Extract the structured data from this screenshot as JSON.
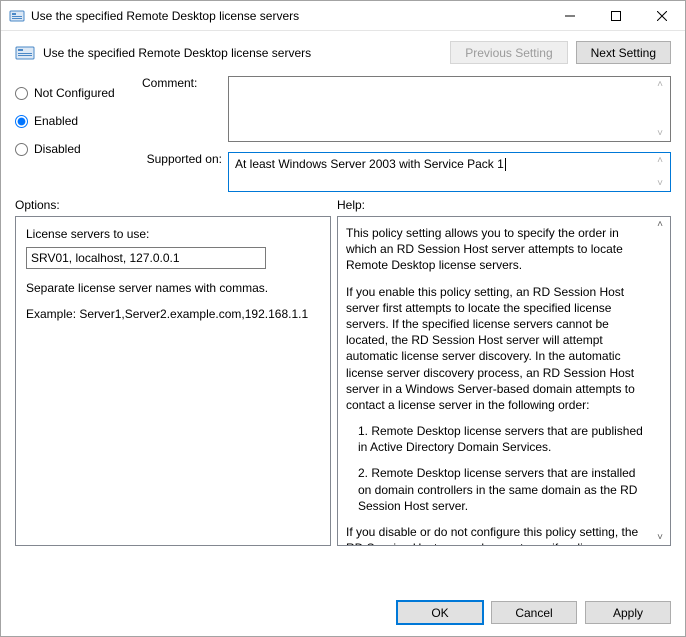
{
  "window": {
    "title": "Use the specified Remote Desktop license servers"
  },
  "header": {
    "policy_name": "Use the specified Remote Desktop license servers",
    "prev_label": "Previous Setting",
    "next_label": "Next Setting"
  },
  "state": {
    "not_configured_label": "Not Configured",
    "enabled_label": "Enabled",
    "disabled_label": "Disabled",
    "comment_label": "Comment:",
    "comment_value": "",
    "supported_label": "Supported on:",
    "supported_value": "At least Windows Server 2003 with Service Pack 1"
  },
  "sections": {
    "options_label": "Options:",
    "help_label": "Help:"
  },
  "options": {
    "license_label": "License servers to use:",
    "license_value": "SRV01, localhost, 127.0.0.1",
    "note": "Separate license server names with commas.",
    "example": "Example: Server1,Server2.example.com,192.168.1.1"
  },
  "help": {
    "p1": "This policy setting allows you to specify the order in which an RD Session Host server attempts to locate Remote Desktop license servers.",
    "p2": "If you enable this policy setting, an RD Session Host server first attempts to locate the specified license servers. If the specified license servers cannot be located, the RD Session Host server will attempt automatic license server discovery. In the automatic license server discovery process, an RD Session Host server in a Windows Server-based domain attempts to contact a license server in the following order:",
    "p3": "1. Remote Desktop license servers that are published in Active Directory Domain Services.",
    "p4": "2. Remote Desktop license servers that are installed on domain controllers in the same domain as the RD Session Host server.",
    "p5": "If you disable or do not configure this policy setting, the RD Session Host server does not specify a license server at the Group Policy level."
  },
  "footer": {
    "ok": "OK",
    "cancel": "Cancel",
    "apply": "Apply"
  }
}
